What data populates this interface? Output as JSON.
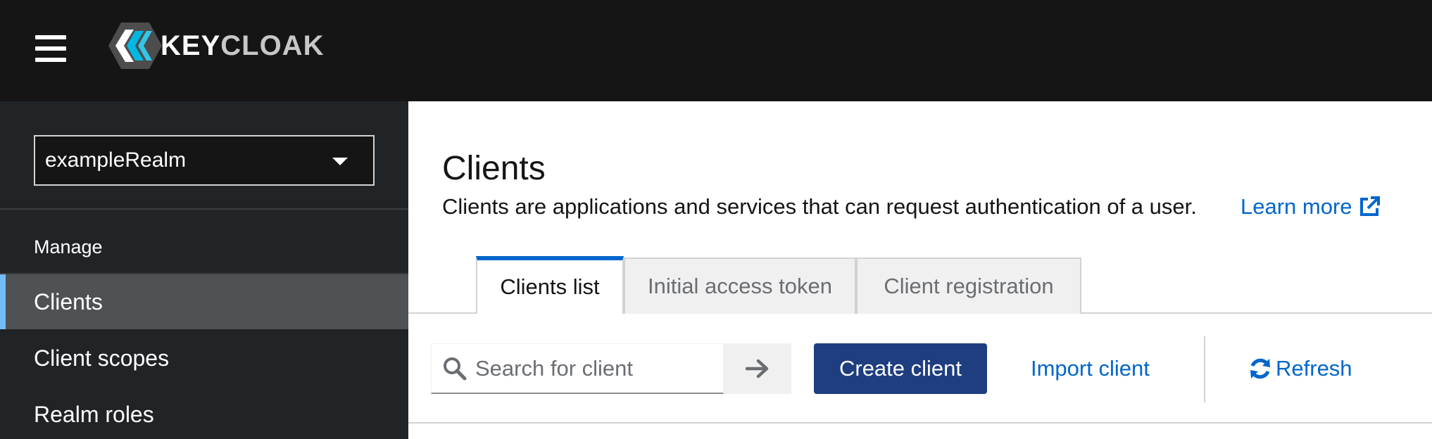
{
  "masthead": {
    "brand_primary": "KEY",
    "brand_secondary": "CLOAK"
  },
  "sidebar": {
    "realm_selector": "exampleRealm",
    "section_title": "Manage",
    "items": [
      {
        "label": "Clients",
        "active": true
      },
      {
        "label": "Client scopes",
        "active": false
      },
      {
        "label": "Realm roles",
        "active": false
      }
    ]
  },
  "main": {
    "title": "Clients",
    "description": "Clients are applications and services that can request authentication of a user.",
    "learn_more": "Learn more",
    "tabs": [
      {
        "label": "Clients list",
        "active": true
      },
      {
        "label": "Initial access token",
        "active": false
      },
      {
        "label": "Client registration",
        "active": false
      }
    ],
    "toolbar": {
      "search_placeholder": "Search for client",
      "create_label": "Create client",
      "import_label": "Import client",
      "refresh_label": "Refresh"
    }
  },
  "colors": {
    "masthead_bg": "#151515",
    "sidebar_bg": "#212427",
    "active_nav_bg": "#4f5255",
    "active_accent": "#73bcf7",
    "primary_button": "#1f3e80",
    "link": "#0066cc"
  },
  "icons": {
    "menu": "hamburger-icon",
    "brand": "keycloak-logo",
    "realm_caret": "caret-down-icon",
    "external": "external-link-icon",
    "search": "search-icon",
    "go": "arrow-right-icon",
    "refresh": "refresh-icon"
  }
}
